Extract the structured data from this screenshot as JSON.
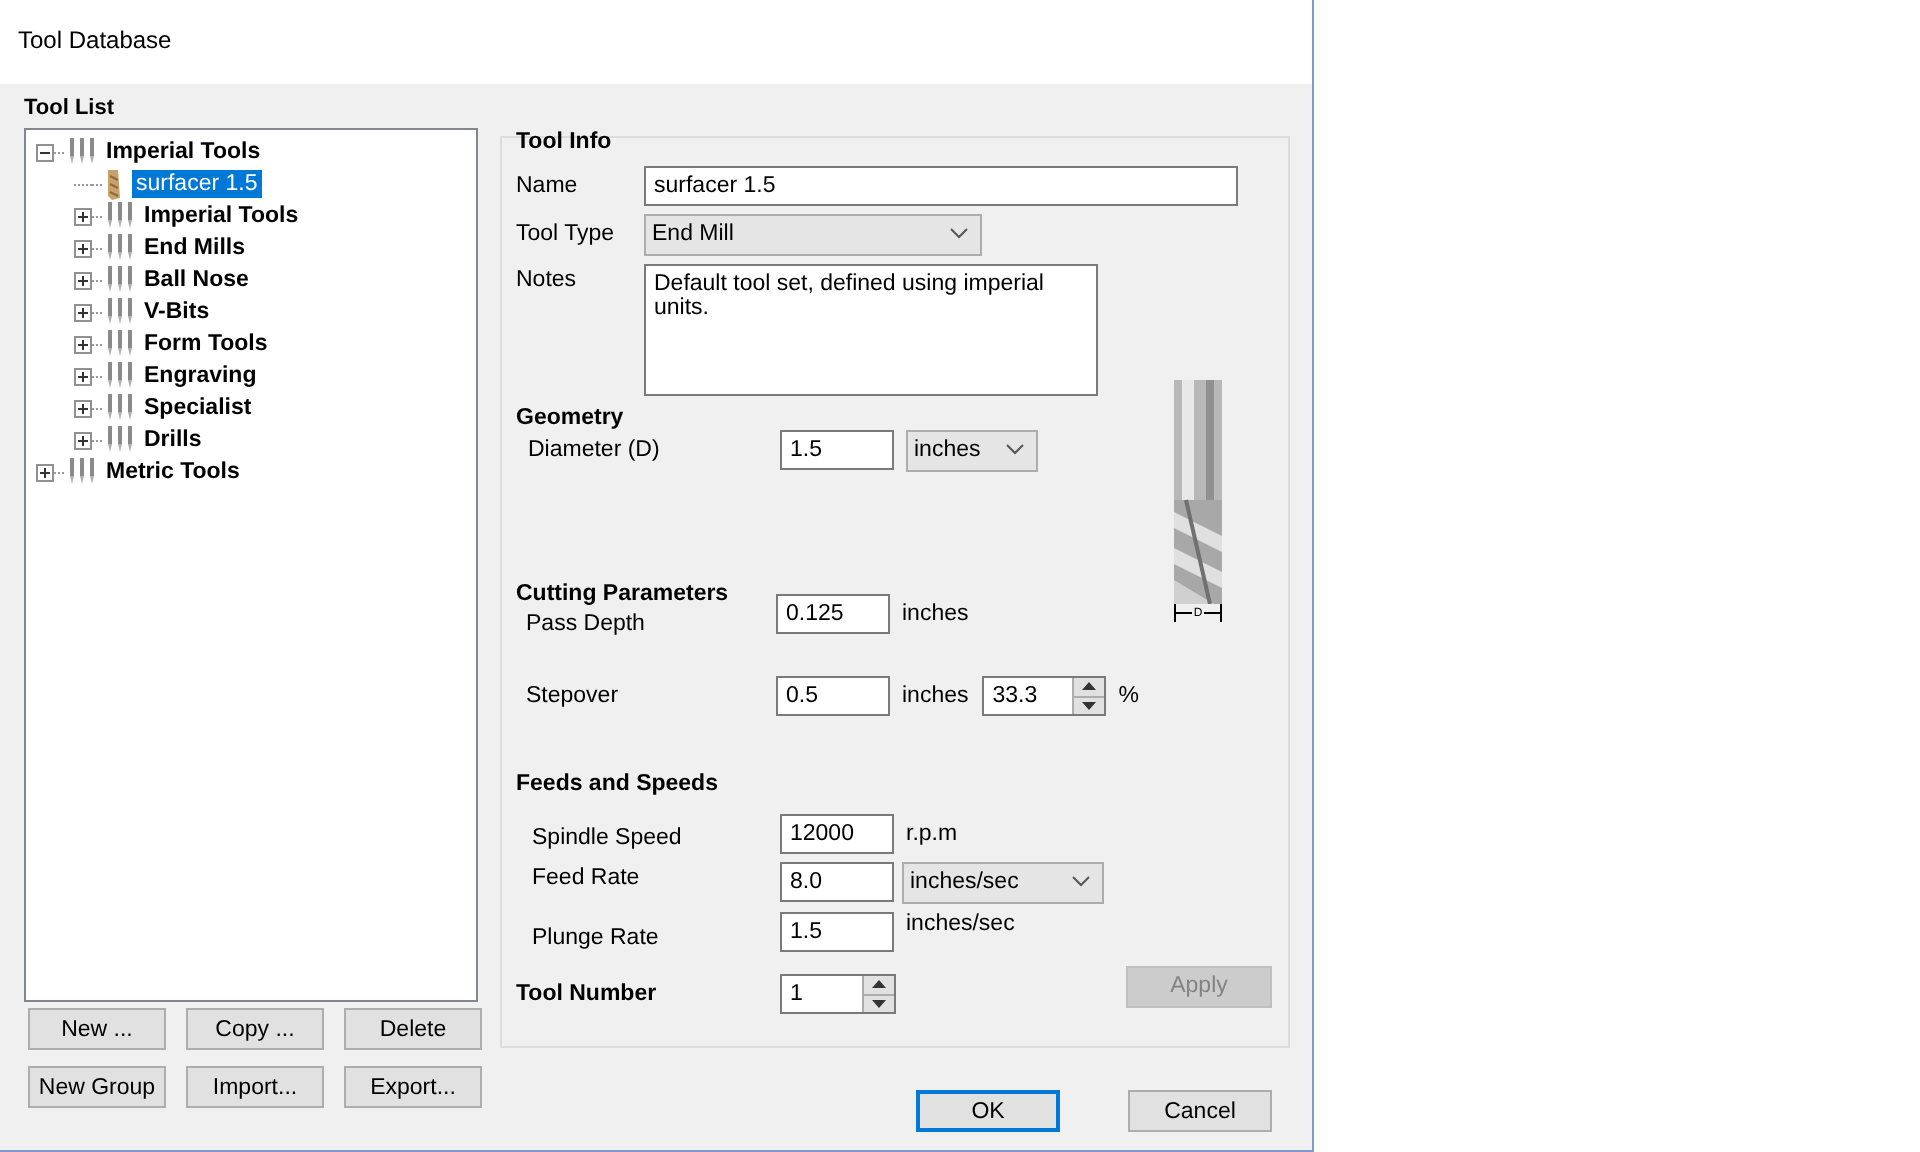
{
  "window": {
    "title": "Tool Database"
  },
  "tool_list": {
    "title": "Tool List",
    "tree": [
      {
        "label": "Imperial Tools",
        "kind": "group",
        "expanded": true,
        "selected": false,
        "children": [
          {
            "label": "surfacer 1.5",
            "kind": "tool",
            "selected": true
          },
          {
            "label": "Imperial Tools",
            "kind": "group",
            "expanded": false,
            "selected": false
          },
          {
            "label": "End Mills",
            "kind": "group",
            "expanded": false,
            "selected": false
          },
          {
            "label": "Ball Nose",
            "kind": "group",
            "expanded": false,
            "selected": false
          },
          {
            "label": "V-Bits",
            "kind": "group",
            "expanded": false,
            "selected": false
          },
          {
            "label": "Form Tools",
            "kind": "group",
            "expanded": false,
            "selected": false
          },
          {
            "label": "Engraving",
            "kind": "group",
            "expanded": false,
            "selected": false
          },
          {
            "label": "Specialist",
            "kind": "group",
            "expanded": false,
            "selected": false
          },
          {
            "label": "Drills",
            "kind": "group",
            "expanded": false,
            "selected": false
          }
        ]
      },
      {
        "label": "Metric Tools",
        "kind": "group",
        "expanded": false,
        "selected": false
      }
    ],
    "buttons": [
      "New ...",
      "Copy ...",
      "Delete",
      "New Group",
      "Import...",
      "Export..."
    ]
  },
  "tool_info": {
    "title": "Tool Info",
    "name_label": "Name",
    "name": "surfacer 1.5",
    "type_label": "Tool Type",
    "tool_type": "End Mill",
    "notes_label": "Notes",
    "notes": "Default tool set, defined using imperial units."
  },
  "geometry": {
    "title": "Geometry",
    "diameter_label": "Diameter (D)",
    "diameter": "1.5",
    "diameter_unit": "inches",
    "dimension_mark": "D"
  },
  "cutting_parameters": {
    "title": "Cutting Parameters",
    "pass_depth_label": "Pass Depth",
    "pass_depth": "0.125",
    "pass_depth_unit": "inches",
    "stepover_label": "Stepover",
    "stepover": "0.5",
    "stepover_unit": "inches",
    "stepover_percent": "33.3",
    "percent_sign": "%"
  },
  "feeds_and_speeds": {
    "title": "Feeds and Speeds",
    "spindle_label": "Spindle Speed",
    "spindle_speed": "12000",
    "spindle_unit": "r.p.m",
    "feed_label": "Feed Rate",
    "feed_rate": "8.0",
    "feed_unit": "inches/sec",
    "plunge_label": "Plunge Rate",
    "plunge_rate": "1.5",
    "plunge_unit": "inches/sec"
  },
  "tool_number": {
    "label": "Tool Number",
    "value": "1"
  },
  "apply_button": {
    "label": "Apply",
    "disabled": true
  },
  "dialog_buttons": [
    {
      "label": "OK",
      "default": true
    },
    {
      "label": "Cancel",
      "default": false
    }
  ]
}
